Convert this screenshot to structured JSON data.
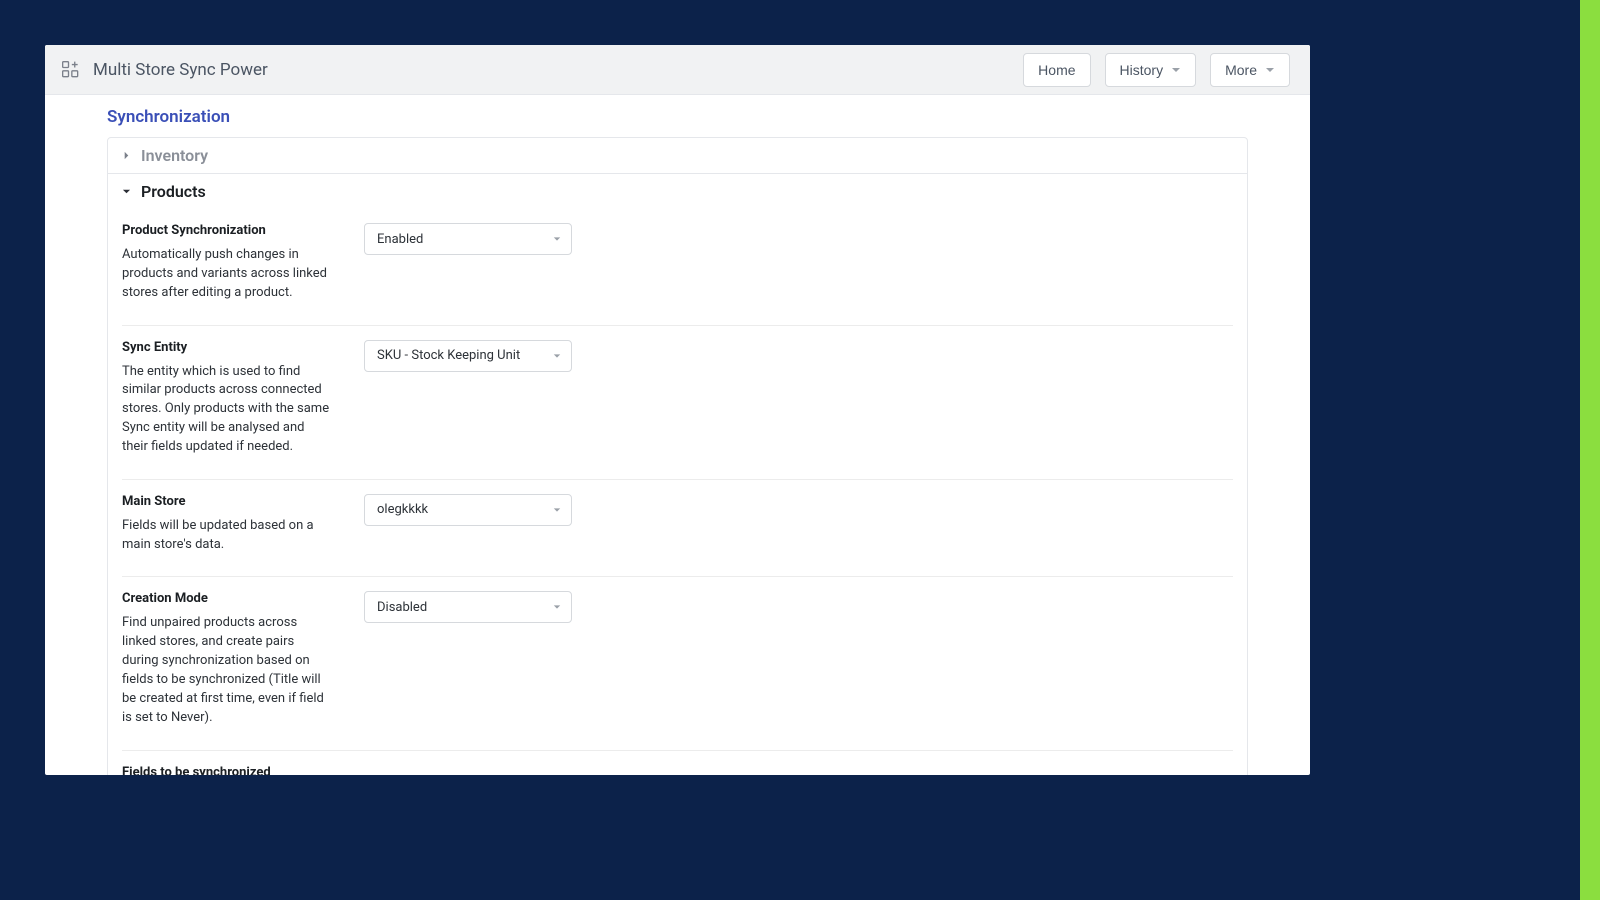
{
  "header": {
    "app_title": "Multi Store Sync Power",
    "home": "Home",
    "history": "History",
    "more": "More"
  },
  "page": {
    "title": "Synchronization",
    "sections": {
      "inventory": {
        "label": "Inventory"
      },
      "products": {
        "label": "Products"
      }
    }
  },
  "fields": {
    "product_sync": {
      "label": "Product Synchronization",
      "help": "Automatically push changes in products and variants across linked stores after editing a product.",
      "value": "Enabled"
    },
    "sync_entity": {
      "label": "Sync Entity",
      "help": "The entity which is used to find similar products across connected stores. Only products with the same Sync entity will be analysed and their fields updated if needed.",
      "value": "SKU - Stock Keeping Unit"
    },
    "main_store": {
      "label": "Main Store",
      "help": "Fields will be updated based on a main store's data.",
      "value": "olegkkkk"
    },
    "creation_mode": {
      "label": "Creation Mode",
      "help": "Find unpaired products across linked stores, and create pairs during synchronization based on fields to be synchronized (Title will be created at first time, even if field is set to Never).",
      "value": "Disabled"
    },
    "fields_to_sync": {
      "label": "Fields to be synchronized"
    }
  }
}
